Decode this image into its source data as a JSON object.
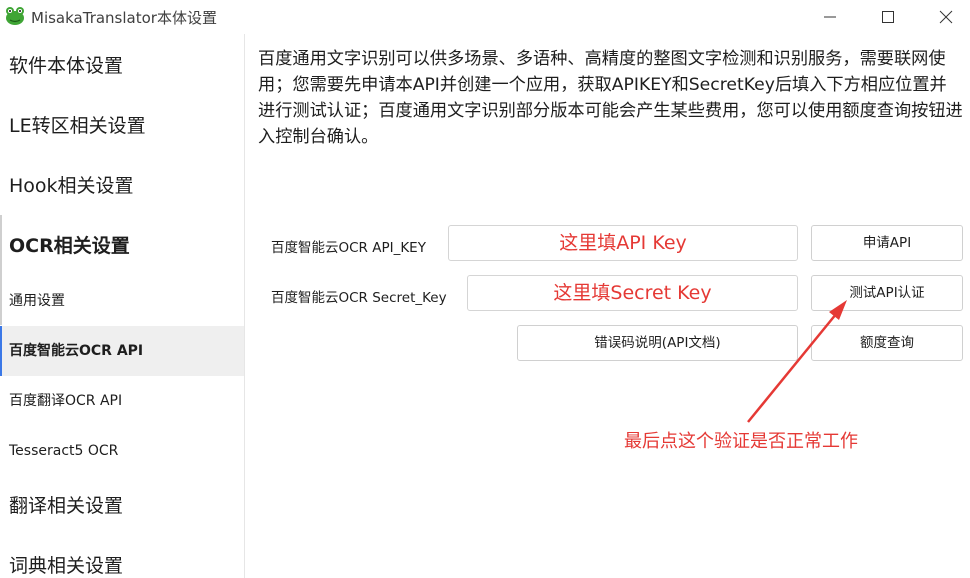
{
  "window": {
    "title": "MisakaTranslator本体设置"
  },
  "sidebar": {
    "items": [
      {
        "label": "软件本体设置"
      },
      {
        "label": "LE转区相关设置"
      },
      {
        "label": "Hook相关设置"
      },
      {
        "label": "OCR相关设置"
      },
      {
        "label": "通用设置"
      },
      {
        "label": "百度智能云OCR API"
      },
      {
        "label": "百度翻译OCR API"
      },
      {
        "label": "Tesseract5 OCR"
      },
      {
        "label": "翻译相关设置"
      },
      {
        "label": "词典相关设置"
      }
    ],
    "active_index": 5
  },
  "main": {
    "description": "百度通用文字识别可以供多场景、多语种、高精度的整图文字检测和识别服务，需要联网使用；您需要先申请本API并创建一个应用，获取APIKEY和SecretKey后填入下方相应位置并进行测试认证；百度通用文字识别部分版本可能会产生某些费用，您可以使用额度查询按钮进入控制台确认。",
    "api_key_label": "百度智能云OCR API_KEY",
    "api_key_value": "这里填API Key",
    "secret_key_label": "百度智能云OCR Secret_Key",
    "secret_key_value": "这里填Secret Key",
    "apply_button": "申请API",
    "test_button": "测试API认证",
    "error_doc_button": "错误码说明(API文档)",
    "quota_button": "额度查询",
    "annotation": "最后点这个验证是否正常工作"
  },
  "colors": {
    "annotation_red": "#e53935",
    "active_item_bg": "#efefef",
    "icon_green": "#3fa535"
  }
}
